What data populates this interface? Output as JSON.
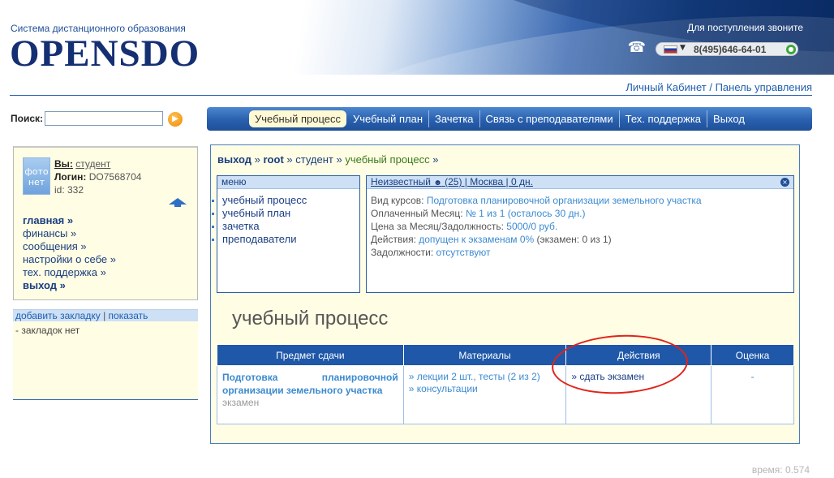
{
  "header": {
    "logo_caption": "Система дистанционного образования",
    "logo_text": "OPENSDO",
    "call_caption": "Для поступления звоните",
    "phone_number": "8(495)646-64-01",
    "cabinet_link": "Личный Кабинет / Панель управления"
  },
  "search": {
    "label": "Поиск:",
    "value": ""
  },
  "nav": {
    "items": [
      "Учебный процесс",
      "Учебный план",
      "Зачетка",
      "Связь с преподавателями",
      "Тех. поддержка",
      "Выход"
    ],
    "active_index": 0
  },
  "profile": {
    "avatar_text": "фото нет",
    "you_label": "Вы:",
    "you_value": "студент",
    "login_label": "Логин:",
    "login_value": "DO7568704",
    "id_line": "id: 332",
    "menu": [
      "главная »",
      "финансы »",
      "сообщения »",
      "настройки о себе »",
      "тех. поддержка »",
      "выход »"
    ]
  },
  "bookmarks": {
    "add_label": "добавить закладку",
    "separator": " | ",
    "show_label": "показать",
    "empty_text": "- закладок нет"
  },
  "breadcrumb": {
    "exit": "выход",
    "sep": " » ",
    "root": "root",
    "student": "студент",
    "current": "учебный процесс",
    "tail": " »"
  },
  "menu_box": {
    "title": "меню",
    "items": [
      "учебный процесс",
      "учебный план",
      "зачетка",
      "преподаватели"
    ]
  },
  "info_box": {
    "title_pre": "Неизвестный ",
    "title_post": " (25) | Москва | 0 дн.",
    "course_label": "Вид курсов: ",
    "course_value": "Подготовка планировочной организации земельного участка",
    "month_label": "Оплаченный Месяц: ",
    "month_value": "№ 1 из 1 (осталось 30 дн.)",
    "price_label": "Цена за Месяц/Задолжность: ",
    "price_value": "5000/0 руб.",
    "actions_label": "Действия: ",
    "actions_value": "допущен к экзаменам 0%",
    "actions_suffix": " (экзамен: 0 из 1)",
    "debt_label": "Задолжности: ",
    "debt_value": "отсутствуют"
  },
  "section_title": "учебный процесс",
  "subjects_table": {
    "headers": [
      "Предмет сдачи",
      "Материалы",
      "Действия",
      "Оценка"
    ],
    "rows": [
      {
        "subject": "Подготовка планировочной организации земельного участка",
        "type": "экзамен",
        "materials": [
          "» лекции 2 шт., тесты (2 из 2)",
          "» консультации"
        ],
        "action": "» сдать экзамен",
        "grade": "-"
      }
    ]
  },
  "timing": "время: 0.574",
  "colors": {
    "nav_blue": "#2960ae",
    "panel_bg": "#fffde3",
    "link_blue": "#3b8ad0",
    "annotation_red": "#e0241b"
  },
  "icons": {
    "phone": "phone-icon",
    "flag": "russia-flag-icon",
    "search_go": "arrow-right-icon",
    "up": "up-arrow-icon",
    "close": "close-icon"
  }
}
